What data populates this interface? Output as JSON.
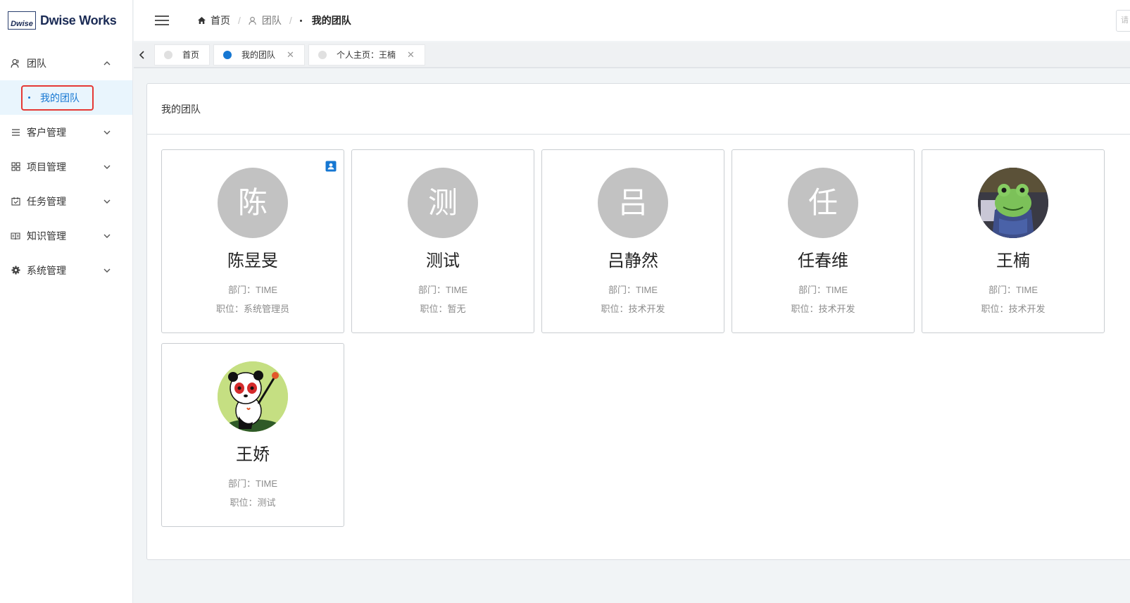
{
  "logo": {
    "mark": "Dwise",
    "name": "Dwise Works"
  },
  "sidebar": {
    "items": [
      {
        "label": "团队",
        "icon": "team-icon",
        "expanded": true
      },
      {
        "label": "客户管理",
        "icon": "list-icon"
      },
      {
        "label": "项目管理",
        "icon": "grid-icon"
      },
      {
        "label": "任务管理",
        "icon": "calendar-check-icon"
      },
      {
        "label": "知识管理",
        "icon": "book-icon"
      },
      {
        "label": "系统管理",
        "icon": "gear-icon"
      }
    ],
    "submenu": {
      "label": "我的团队"
    }
  },
  "header": {
    "breadcrumb": [
      "首页",
      "团队",
      "我的团队"
    ],
    "search_placeholder": "请"
  },
  "tabs": [
    {
      "label": "首页",
      "active": false,
      "closable": false
    },
    {
      "label": "我的团队",
      "active": true,
      "closable": true
    },
    {
      "label": "个人主页：王楠",
      "active": false,
      "closable": true
    }
  ],
  "panel": {
    "title": "我的团队"
  },
  "members": [
    {
      "initial": "陈",
      "name": "陈昱旻",
      "dept": "部门：TIME",
      "position": "职位：系统管理员",
      "avatar": "initial",
      "badge": true
    },
    {
      "initial": "测",
      "name": "测试",
      "dept": "部门：TIME",
      "position": "职位：暂无",
      "avatar": "initial"
    },
    {
      "initial": "吕",
      "name": "吕静然",
      "dept": "部门：TIME",
      "position": "职位：技术开发",
      "avatar": "initial"
    },
    {
      "initial": "任",
      "name": "任春维",
      "dept": "部门：TIME",
      "position": "职位：技术开发",
      "avatar": "initial"
    },
    {
      "initial": "",
      "name": "王楠",
      "dept": "部门：TIME",
      "position": "职位：技术开发",
      "avatar": "frog-photo"
    },
    {
      "initial": "",
      "name": "王娇",
      "dept": "部门：TIME",
      "position": "职位：测试",
      "avatar": "panda-illustration"
    }
  ],
  "colors": {
    "accent": "#1677d2",
    "highlight_border": "#e53935",
    "avatar_gray": "#c2c2c2"
  }
}
